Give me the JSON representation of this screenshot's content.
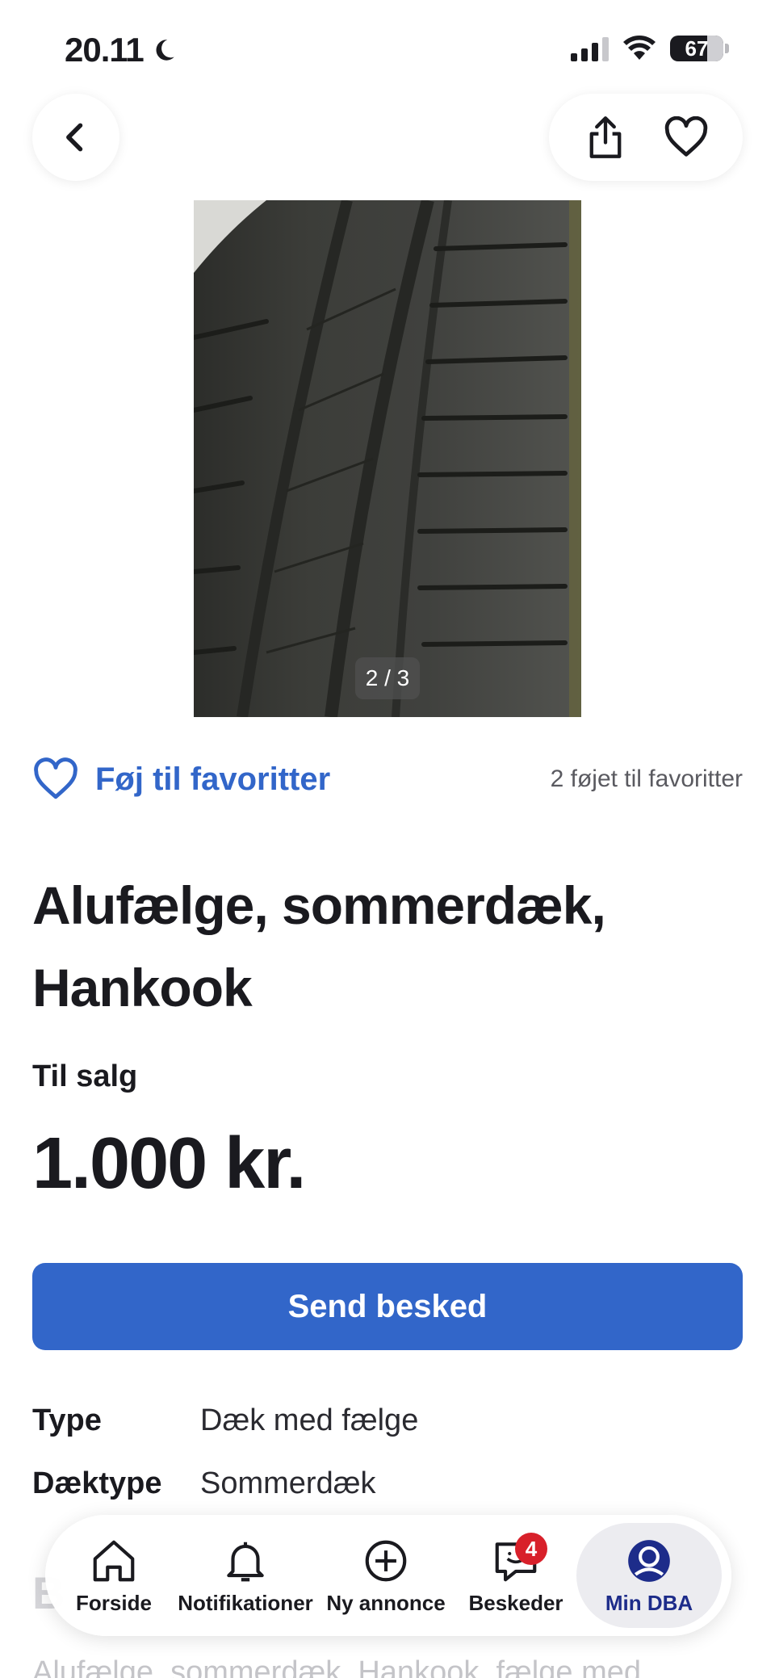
{
  "status_bar": {
    "time": "20.11",
    "battery": "67"
  },
  "gallery": {
    "counter": "2 / 3"
  },
  "favorites": {
    "button_label": "Føj til favoritter",
    "count_text": "2 føjet til favoritter"
  },
  "listing": {
    "title": "Alufælge, sommerdæk, Hankook",
    "sale_type": "Til salg",
    "price": "1.000 kr.",
    "send_button": "Send besked",
    "specs": [
      {
        "key": "Type",
        "value": "Dæk med fælge"
      },
      {
        "key": "Dæktype",
        "value": "Sommerdæk"
      }
    ],
    "section_heading_peek": "B",
    "description_peek": "Alufælge, sommerdæk, Hankook, fælge med"
  },
  "tabbar": {
    "tabs": [
      {
        "label": "Forside",
        "icon": "home-icon"
      },
      {
        "label": "Notifikationer",
        "icon": "bell-icon"
      },
      {
        "label": "Ny annonce",
        "icon": "plus-circle-icon"
      },
      {
        "label": "Beskeder",
        "icon": "chat-icon",
        "badge": "4"
      },
      {
        "label": "Min DBA",
        "icon": "profile-icon",
        "active": true
      }
    ]
  },
  "colors": {
    "accent": "#3266c9",
    "active_tab": "#1d2c8a",
    "badge": "#d8202a"
  }
}
